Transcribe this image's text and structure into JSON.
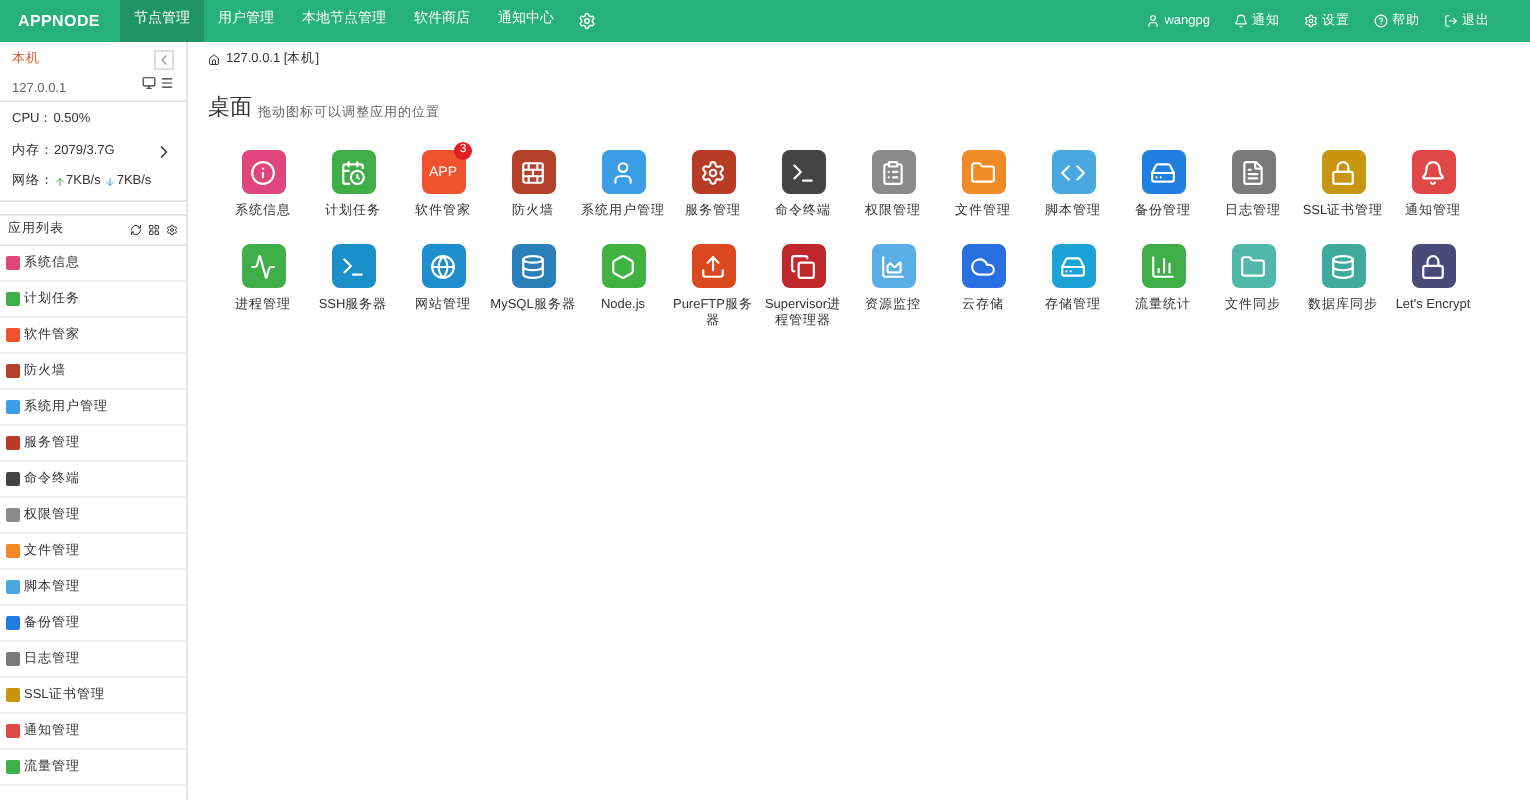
{
  "brand": "APPNODE",
  "nav": [
    {
      "label": "节点管理",
      "selected": true
    },
    {
      "label": "用户管理",
      "selected": false
    },
    {
      "label": "本地节点管理",
      "selected": false
    },
    {
      "label": "软件商店",
      "selected": false
    },
    {
      "label": "通知中心",
      "selected": false
    }
  ],
  "user_menu": [
    {
      "kind": "user",
      "label": "wangpg"
    },
    {
      "kind": "bell",
      "label": "通知"
    },
    {
      "kind": "gear",
      "label": "设置"
    },
    {
      "kind": "help",
      "label": "帮助"
    },
    {
      "kind": "logout",
      "label": "退出"
    }
  ],
  "node": {
    "name": "本机",
    "ip": "127.0.0.1",
    "cpu": "CPU：0.50%",
    "memory": "内存：2079/3.7G",
    "network_label": "网络：",
    "upload": "7KB/s",
    "download": "7KB/s"
  },
  "app_list_title": "应用列表",
  "sidebar": [
    {
      "label": "系统信息",
      "color": "#e0457b"
    },
    {
      "label": "计划任务",
      "color": "#3fae49"
    },
    {
      "label": "软件管家",
      "color": "#f0522d"
    },
    {
      "label": "防火墙",
      "color": "#b5402a"
    },
    {
      "label": "系统用户管理",
      "color": "#3a9ee6"
    },
    {
      "label": "服务管理",
      "color": "#b83c25"
    },
    {
      "label": "命令终端",
      "color": "#444444"
    },
    {
      "label": "权限管理",
      "color": "#8a8a8a"
    },
    {
      "label": "文件管理",
      "color": "#f08a24"
    },
    {
      "label": "脚本管理",
      "color": "#4aa8e0"
    },
    {
      "label": "备份管理",
      "color": "#1f7fe0"
    },
    {
      "label": "日志管理",
      "color": "#7a7a7a"
    },
    {
      "label": "SSL证书管理",
      "color": "#c8960e"
    },
    {
      "label": "通知管理",
      "color": "#e04848"
    },
    {
      "label": "流量管理",
      "color": "#3fae49"
    }
  ],
  "breadcrumb": "127.0.0.1 [本机]",
  "desktop": {
    "title": "桌面",
    "subtitle": "拖动图标可以调整应用的位置"
  },
  "apps": [
    {
      "label": "系统信息",
      "color": "#e0457b",
      "kind": "info"
    },
    {
      "label": "计划任务",
      "color": "#3fae49",
      "kind": "calendar"
    },
    {
      "label": "软件管家",
      "color": "#f0522d",
      "kind": "app",
      "icon_text": "APP",
      "badge": "3"
    },
    {
      "label": "防火墙",
      "color": "#b5402a",
      "kind": "wall"
    },
    {
      "label": "系统用户管理",
      "color": "#3a9ee6",
      "kind": "user"
    },
    {
      "label": "服务管理",
      "color": "#b83c25",
      "kind": "gear"
    },
    {
      "label": "命令终端",
      "color": "#444444",
      "kind": "terminal"
    },
    {
      "label": "权限管理",
      "color": "#8a8a8a",
      "kind": "list"
    },
    {
      "label": "文件管理",
      "color": "#f08a24",
      "kind": "folder"
    },
    {
      "label": "脚本管理",
      "color": "#4aa8e0",
      "kind": "code"
    },
    {
      "label": "备份管理",
      "color": "#1f7fe0",
      "kind": "drive"
    },
    {
      "label": "日志管理",
      "color": "#7a7a7a",
      "kind": "file"
    },
    {
      "label": "SSL证书管理",
      "color": "#c8960e",
      "kind": "lock"
    },
    {
      "label": "通知管理",
      "color": "#e04848",
      "kind": "bell"
    },
    {
      "label": "进程管理",
      "color": "#3fae49",
      "kind": "pulse"
    },
    {
      "label": "SSH服务器",
      "color": "#1b8fc7",
      "kind": "terminal"
    },
    {
      "label": "网站管理",
      "color": "#1f8ecf",
      "kind": "globe"
    },
    {
      "label": "MySQL服务器",
      "color": "#2a7fb8",
      "kind": "db"
    },
    {
      "label": "Node.js",
      "color": "#3fb23f",
      "kind": "hex"
    },
    {
      "label": "PureFTP服务器",
      "color": "#d9481e",
      "kind": "upload"
    },
    {
      "label": "Supervisor进程管理器",
      "color": "#c0282c",
      "kind": "copy"
    },
    {
      "label": "资源监控",
      "color": "#5aaee6",
      "kind": "chart"
    },
    {
      "label": "云存储",
      "color": "#2a6fe0",
      "kind": "cloud"
    },
    {
      "label": "存储管理",
      "color": "#1ca3d6",
      "kind": "drive"
    },
    {
      "label": "流量统计",
      "color": "#3fae49",
      "kind": "bars"
    },
    {
      "label": "文件同步",
      "color": "#4fb8a8",
      "kind": "folder"
    },
    {
      "label": "数据库同步",
      "color": "#3fa99c",
      "kind": "db"
    },
    {
      "label": "Let's Encrypt",
      "color": "#4a4a7a",
      "kind": "lock"
    }
  ]
}
